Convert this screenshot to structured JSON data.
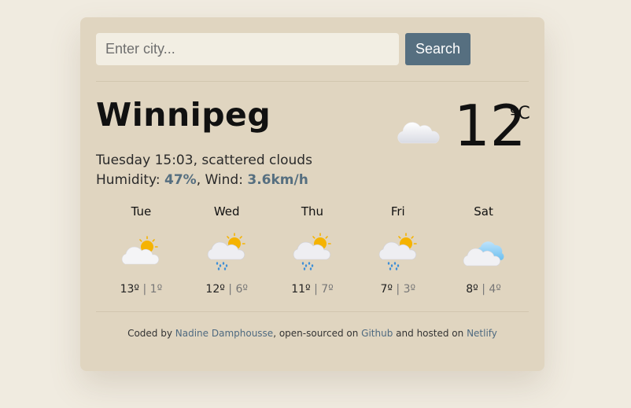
{
  "search": {
    "placeholder": "Enter city...",
    "button_label": "Search"
  },
  "current": {
    "city": "Winnipeg",
    "day_time": "Tuesday 15:03",
    "conditions": "scattered clouds",
    "humidity_label": "Humidity:",
    "humidity": "47%",
    "wind_label": "Wind:",
    "wind": "3.6km/h",
    "temperature": "12",
    "unit": "ºC",
    "icon": "cloud-icon"
  },
  "forecast": [
    {
      "day": "Tue",
      "max": "13º",
      "min": "1º",
      "icon": "partly-cloudy-icon"
    },
    {
      "day": "Wed",
      "max": "12º",
      "min": "6º",
      "icon": "rain-sun-icon"
    },
    {
      "day": "Thu",
      "max": "11º",
      "min": "7º",
      "icon": "rain-sun-icon"
    },
    {
      "day": "Fri",
      "max": "7º",
      "min": "3º",
      "icon": "rain-sun-icon"
    },
    {
      "day": "Sat",
      "max": "8º",
      "min": "4º",
      "icon": "cloudy-icon"
    }
  ],
  "footer": {
    "prefix": "Coded by",
    "author": "Nadine Damphousse",
    "middle": ", open-sourced on",
    "github": "Github",
    "and_hosted": "and hosted on",
    "netlify": "Netlify"
  },
  "colors": {
    "background": "#f0ebe0",
    "card": "#e0d5c0",
    "accent": "#566f80"
  }
}
